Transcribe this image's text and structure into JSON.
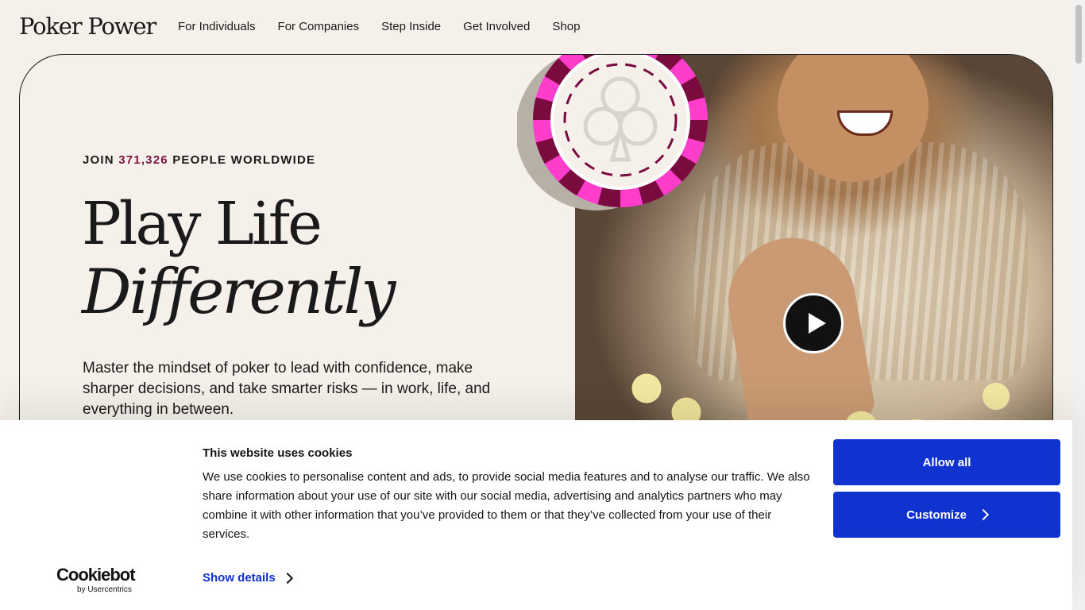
{
  "header": {
    "logo": "Poker Power",
    "nav": [
      "For Individuals",
      "For Companies",
      "Step Inside",
      "Get Involved",
      "Shop"
    ]
  },
  "hero": {
    "kicker_prefix": "JOIN",
    "kicker_count": "371,326",
    "kicker_suffix": "PEOPLE WORLDWIDE",
    "headline_line1": "Play Life",
    "headline_line2": "Differently",
    "subtitle": "Master the mindset of poker to lead with confidence, make sharper decisions, and take smarter risks — in work, life, and everything in between.",
    "accent_color": "#7a1440",
    "chip_colors": {
      "pink": "#ff3dcb",
      "maroon": "#7a0b3f"
    }
  },
  "cookie_banner": {
    "title": "This website uses cookies",
    "text": "We use cookies to personalise content and ads, to provide social media features and to analyse our traffic. We also share information about your use of our site with our social media, advertising and analytics partners who may combine it with other information that you’ve provided to them or that they’ve collected from your use of their services.",
    "show_details": "Show details",
    "allow_all": "Allow all",
    "customize": "Customize",
    "brand_name": "Cookiebot",
    "brand_sub": "by Usercentrics",
    "button_color": "#1032cf"
  }
}
